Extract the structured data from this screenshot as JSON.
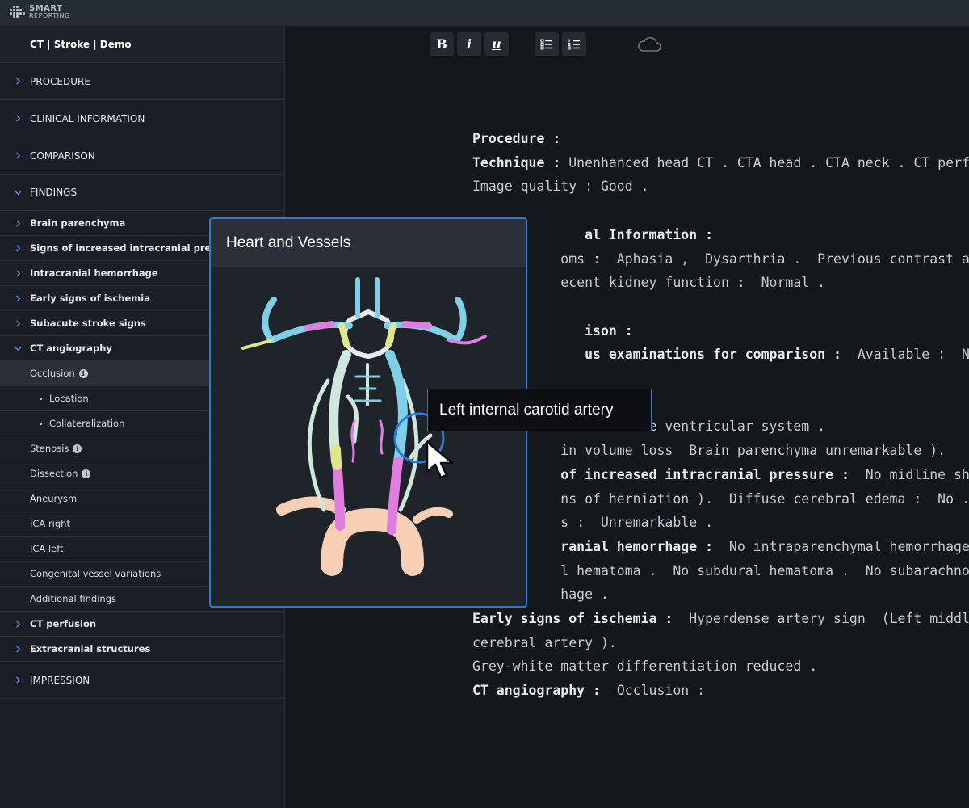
{
  "brand": {
    "line1": "SMART",
    "line2": "REPORTING"
  },
  "document_title": "CT | Stroke | Demo",
  "sidebar": {
    "sections": [
      {
        "label": "PROCEDURE"
      },
      {
        "label": "CLINICAL INFORMATION"
      },
      {
        "label": "COMPARISON"
      },
      {
        "label": "FINDINGS"
      }
    ],
    "findings_items": [
      "Brain parenchyma",
      "Signs of increased intracranial pressure",
      "Intracranial hemorrhage",
      "Early signs of ischemia",
      "Subacute stroke signs",
      "CT angiography"
    ],
    "cta_items": {
      "occlusion": "Occlusion",
      "location": "Location",
      "collateralization": "Collateralization",
      "stenosis": "Stenosis",
      "dissection": "Dissection",
      "aneurysm": "Aneurysm",
      "ica_right": "ICA right",
      "ica_left": "ICA left",
      "congenital": "Congenital vessel variations",
      "additional": "Additional findings"
    },
    "after_items": [
      "CT perfusion",
      "Extracranial structures"
    ],
    "impression": "IMPRESSION",
    "info_glyph": "i"
  },
  "toolbar": {
    "bold": "B",
    "italic": "i",
    "underline": "u"
  },
  "report": {
    "l1": {
      "b": "Procedure :",
      "t": ""
    },
    "l2": {
      "b": "Technique :",
      "t": " Unenhanced head CT .  CTA head .  CTA neck .  CT perf"
    },
    "l3": {
      "b": "",
      "t": "Image quality :  Good ."
    },
    "l4": {
      "b": "              al Information :",
      "t": ""
    },
    "l5": {
      "b": "",
      "t": "           oms :  Aphasia ,  Dysarthria .  Previous contrast agent rea"
    },
    "l6": {
      "b": "",
      "t": "           ecent kidney function :  Normal ."
    },
    "l7": {
      "b": "              ison :",
      "t": ""
    },
    "l8": {
      "b": "              us examinations for comparison :",
      "t": "  Available :  No ."
    },
    "l9": {
      "b": "",
      "t": "              emarkable ventricular system ."
    },
    "l10": {
      "b": "",
      "t": "           in volume loss  Brain parenchyma unremarkable )."
    },
    "l11": {
      "b": "           of increased intracranial pressure :",
      "t": "  No midline shift"
    },
    "l12": {
      "b": "",
      "t": "           ns of herniation ).  Diffuse cerebral edema :  No .  Basal"
    },
    "l13": {
      "b": "",
      "t": "           s :  Unremarkable ."
    },
    "l14": {
      "b": "           ranial hemorrhage :",
      "t": "  No intraparenchymal hemorrhage .  N"
    },
    "l15": {
      "b": "",
      "t": "           l hematoma .  No subdural hematoma .  No subarachnoid"
    },
    "l16": {
      "b": "",
      "t": "           hage ."
    },
    "l17": {
      "b": "Early signs of ischemia :",
      "t": "  Hyperdense artery sign  (Left middl"
    },
    "l18": {
      "b": "",
      "t": "cerebral artery )."
    },
    "l19": {
      "b": "",
      "t": "Grey-white matter differentiation reduced ."
    },
    "l20": {
      "b": "CT angiography :",
      "t": "  Occlusion :"
    }
  },
  "popup": {
    "title": "Heart and Vessels"
  },
  "tooltip": {
    "label": "Left internal carotid artery"
  },
  "colors": {
    "accent": "#2d7ad6",
    "vessel_blue": "#7fcfe6",
    "vessel_pink": "#e07ee0",
    "vessel_yellow": "#e0e68a",
    "vessel_pale": "#cfe7de",
    "aorta": "#f6cfb4"
  }
}
